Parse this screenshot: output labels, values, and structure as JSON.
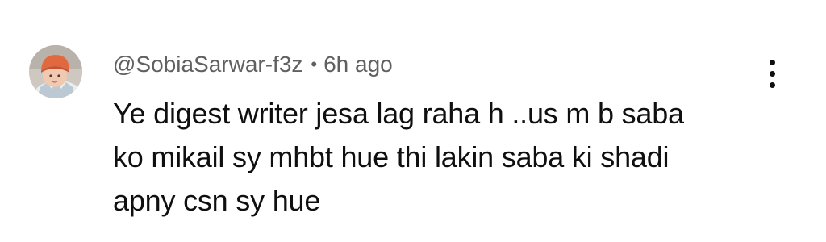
{
  "comment": {
    "author": "@SobiaSarwar-f3z",
    "separator": "•",
    "time": "6h ago",
    "text_lines": [
      "Ye digest writer jesa lag raha h ..us m b saba",
      "ko mikail sy mhbt hue thi lakin saba ki shadi",
      "apny csn sy hue"
    ],
    "avatar_icon": "baby-photo-avatar",
    "menu_icon": "more-vert-icon"
  },
  "colors": {
    "meta_text": "#606060",
    "body_text": "#0f0f0f",
    "background": "#ffffff"
  }
}
